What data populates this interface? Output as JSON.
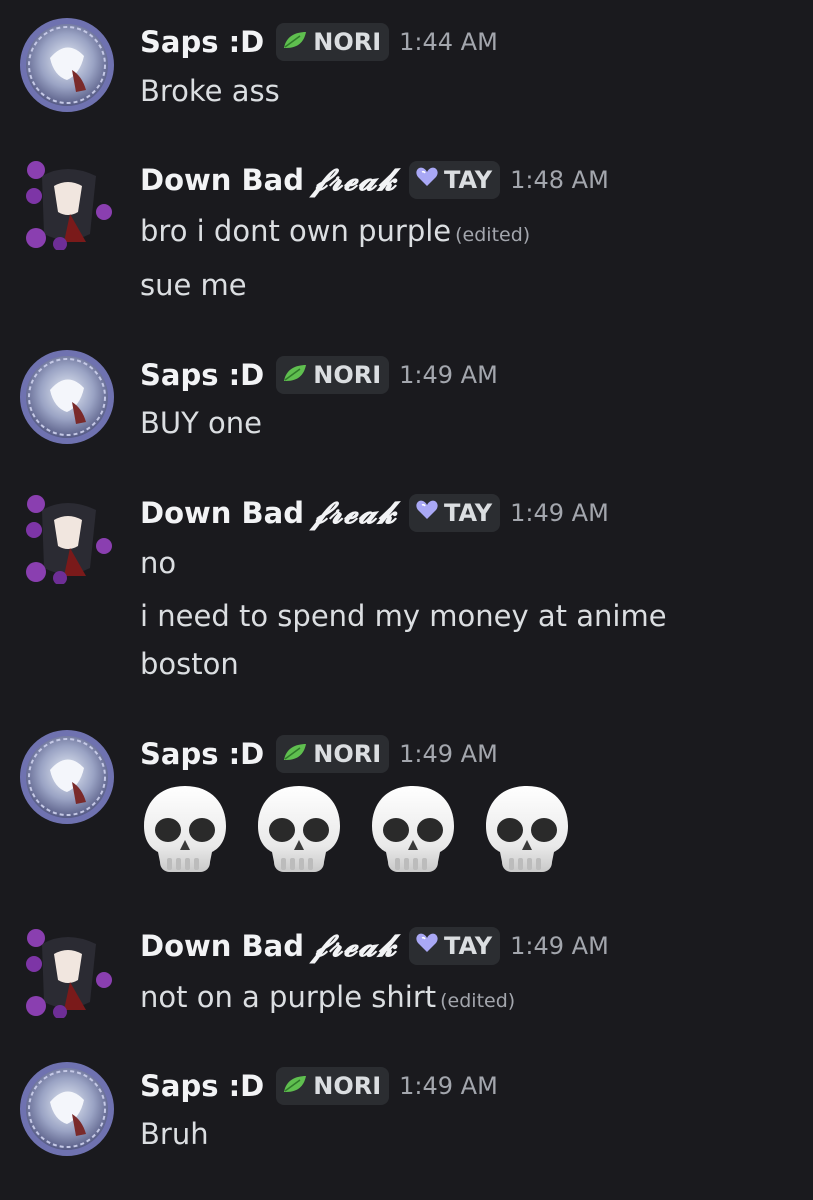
{
  "users": {
    "saps": {
      "name": "Saps :D",
      "tag": "NORI",
      "tag_icon": "leaf-icon",
      "tag_icon_color": "#5fbf4f"
    },
    "downbad": {
      "name": "Down Bad",
      "name_script": "𝓯𝓻𝓮𝓪𝓴",
      "tag": "TAY",
      "tag_icon": "heart-icon",
      "tag_icon_color": "#a9a8f5"
    }
  },
  "messages": [
    {
      "user": "saps",
      "time": "1:44 AM",
      "lines": [
        {
          "text": "Broke ass"
        }
      ]
    },
    {
      "user": "downbad",
      "time": "1:48 AM",
      "lines": [
        {
          "text": "bro i dont own purple",
          "edited": "(edited)"
        },
        {
          "text": "sue me"
        }
      ]
    },
    {
      "user": "saps",
      "time": "1:49 AM",
      "lines": [
        {
          "text": "BUY one"
        }
      ]
    },
    {
      "user": "downbad",
      "time": "1:49 AM",
      "lines": [
        {
          "text": "no"
        },
        {
          "text": "i need to spend my money at anime"
        },
        {
          "text": "boston"
        }
      ]
    },
    {
      "user": "saps",
      "time": "1:49 AM",
      "emoji": [
        "skull",
        "skull",
        "skull",
        "skull"
      ]
    },
    {
      "user": "downbad",
      "time": "1:49 AM",
      "lines": [
        {
          "text": "not on a purple shirt",
          "edited": "(edited)"
        }
      ]
    },
    {
      "user": "saps",
      "time": "1:49 AM",
      "lines": [
        {
          "text": "Bruh"
        }
      ]
    }
  ],
  "colors": {
    "background": "#1a1a1e",
    "username": "#f2f3f5",
    "message_text": "#dbdee1",
    "timestamp": "#a3a6ad",
    "tag_bg": "#2b2d31"
  }
}
